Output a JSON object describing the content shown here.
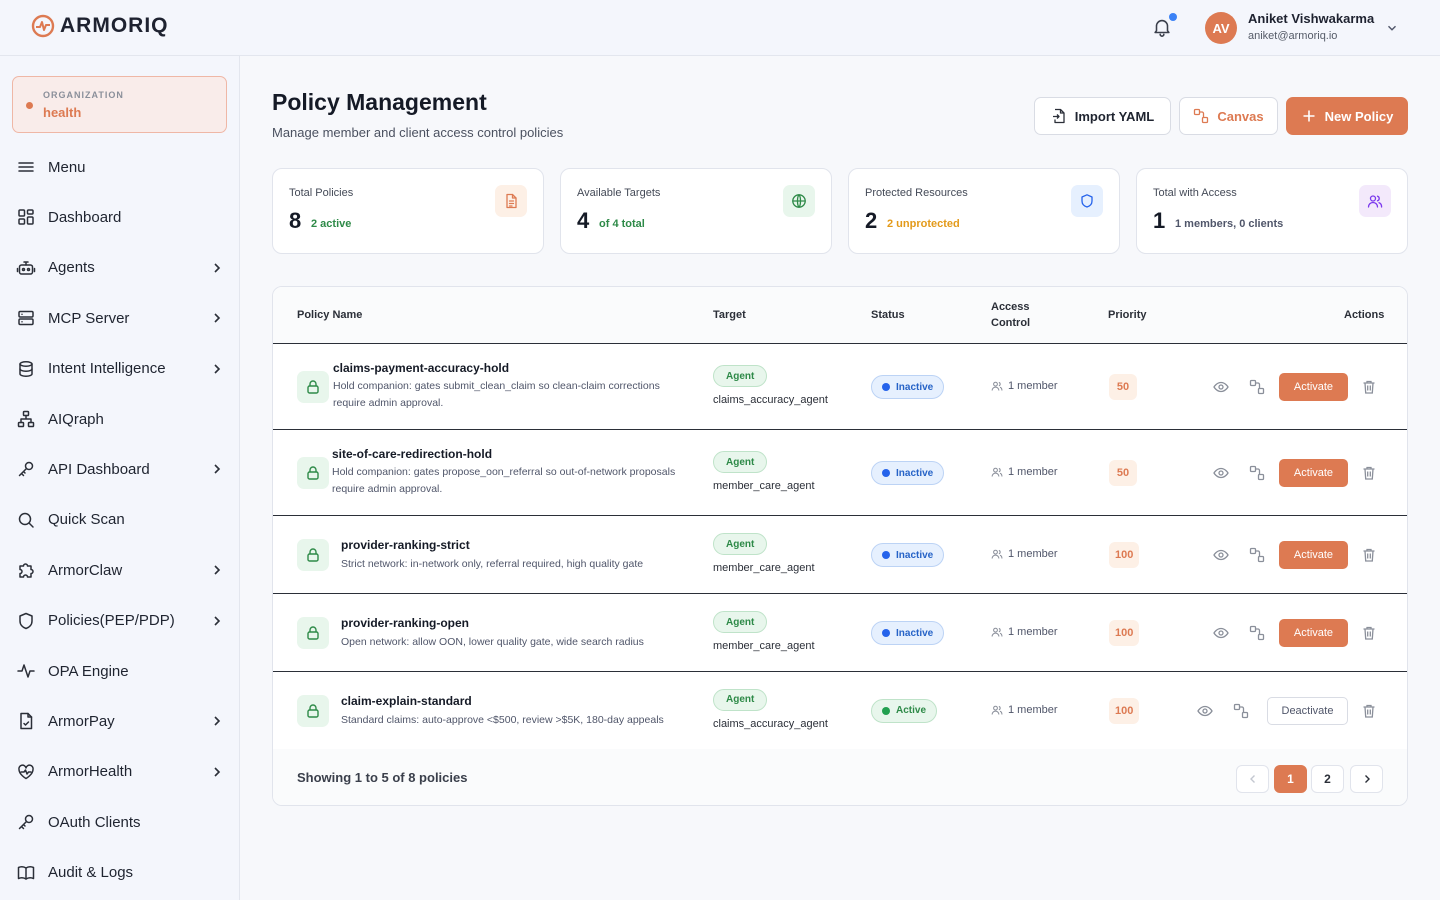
{
  "app": {
    "logo_text": "ARMORIQ"
  },
  "user": {
    "initials": "AV",
    "name": "Aniket Vishwakarma",
    "email": "aniket@armoriq.io"
  },
  "organization": {
    "label": "ORGANIZATION",
    "name": "health"
  },
  "sidebar": {
    "items": [
      {
        "label": "Menu",
        "icon": "menu-icon",
        "has_chevron": false
      },
      {
        "label": "Dashboard",
        "icon": "dashboard-grid-icon",
        "has_chevron": false
      },
      {
        "label": "Agents",
        "icon": "robot-icon",
        "has_chevron": true
      },
      {
        "label": "MCP Server",
        "icon": "server-icon",
        "has_chevron": true
      },
      {
        "label": "Intent Intelligence",
        "icon": "database-icon",
        "has_chevron": true
      },
      {
        "label": "AIQraph",
        "icon": "graph-nodes-icon",
        "has_chevron": false
      },
      {
        "label": "API Dashboard",
        "icon": "key-icon",
        "has_chevron": true
      },
      {
        "label": "Quick Scan",
        "icon": "search-icon",
        "has_chevron": false
      },
      {
        "label": "ArmorClaw",
        "icon": "puzzle-icon",
        "has_chevron": true
      },
      {
        "label": "Policies(PEP/PDP)",
        "icon": "shield-icon",
        "has_chevron": true
      },
      {
        "label": "OPA Engine",
        "icon": "activity-icon",
        "has_chevron": false
      },
      {
        "label": "ArmorPay",
        "icon": "payment-file-icon",
        "has_chevron": true
      },
      {
        "label": "ArmorHealth",
        "icon": "heart-pulse-icon",
        "has_chevron": true
      },
      {
        "label": "OAuth Clients",
        "icon": "key-icon",
        "has_chevron": false
      },
      {
        "label": "Audit & Logs",
        "icon": "book-icon",
        "has_chevron": false
      }
    ]
  },
  "header": {
    "title": "Policy Management",
    "subtitle": "Manage member and client access control policies",
    "import_label": "Import YAML",
    "canvas_label": "Canvas",
    "new_label": "New Policy"
  },
  "stats": [
    {
      "label": "Total Policies",
      "value": "8",
      "sub": "2 active",
      "sub_color": "#2e8a48",
      "icon": "document-icon",
      "icon_bg": "#fdf0e6",
      "icon_color": "#dd7a52"
    },
    {
      "label": "Available Targets",
      "value": "4",
      "sub": "of 4 total",
      "sub_color": "#2e8a48",
      "icon": "globe-icon",
      "icon_bg": "#e8f6ec",
      "icon_color": "#2e8a48"
    },
    {
      "label": "Protected Resources",
      "value": "2",
      "sub": "2 unprotected",
      "sub_color": "#e39a1a",
      "icon": "shield-icon",
      "icon_bg": "#e6f0fe",
      "icon_color": "#2563eb"
    },
    {
      "label": "Total with Access",
      "value": "1",
      "sub": "1 members, 0 clients",
      "sub_color": "#50566a",
      "icon": "users-icon",
      "icon_bg": "#f3e9fb",
      "icon_color": "#7c3aed"
    }
  ],
  "table": {
    "columns": {
      "name": "Policy Name",
      "target": "Target",
      "status": "Status",
      "access_line1": "Access",
      "access_line2": "Control",
      "priority": "Priority",
      "actions": "Actions"
    },
    "rows": [
      {
        "name": "claims-payment-accuracy-hold",
        "desc": "Hold companion: gates submit_clean_claim so clean-claim corrections require admin approval.",
        "target_type": "Agent",
        "target": "claims_accuracy_agent",
        "status": "Inactive",
        "access": "1 member",
        "priority": "50",
        "action": "Activate"
      },
      {
        "name": "site-of-care-redirection-hold",
        "desc": "Hold companion: gates propose_oon_referral so out-of-network proposals require admin approval.",
        "target_type": "Agent",
        "target": "member_care_agent",
        "status": "Inactive",
        "access": "1 member",
        "priority": "50",
        "action": "Activate"
      },
      {
        "name": "provider-ranking-strict",
        "desc": "Strict network: in-network only, referral required, high quality gate",
        "target_type": "Agent",
        "target": "member_care_agent",
        "status": "Inactive",
        "access": "1 member",
        "priority": "100",
        "action": "Activate"
      },
      {
        "name": "provider-ranking-open",
        "desc": "Open network: allow OON, lower quality gate, wide search radius",
        "target_type": "Agent",
        "target": "member_care_agent",
        "status": "Inactive",
        "access": "1 member",
        "priority": "100",
        "action": "Activate"
      },
      {
        "name": "claim-explain-standard",
        "desc": "Standard claims: auto-approve <$500, review >$5K, 180-day appeals",
        "target_type": "Agent",
        "target": "claims_accuracy_agent",
        "status": "Active",
        "access": "1 member",
        "priority": "100",
        "action": "Deactivate"
      }
    ]
  },
  "pagination": {
    "showing": "Showing 1 to 5 of 8 policies",
    "pages": [
      "1",
      "2"
    ],
    "current": "1"
  },
  "colors": {
    "accent": "#dd7a52"
  }
}
